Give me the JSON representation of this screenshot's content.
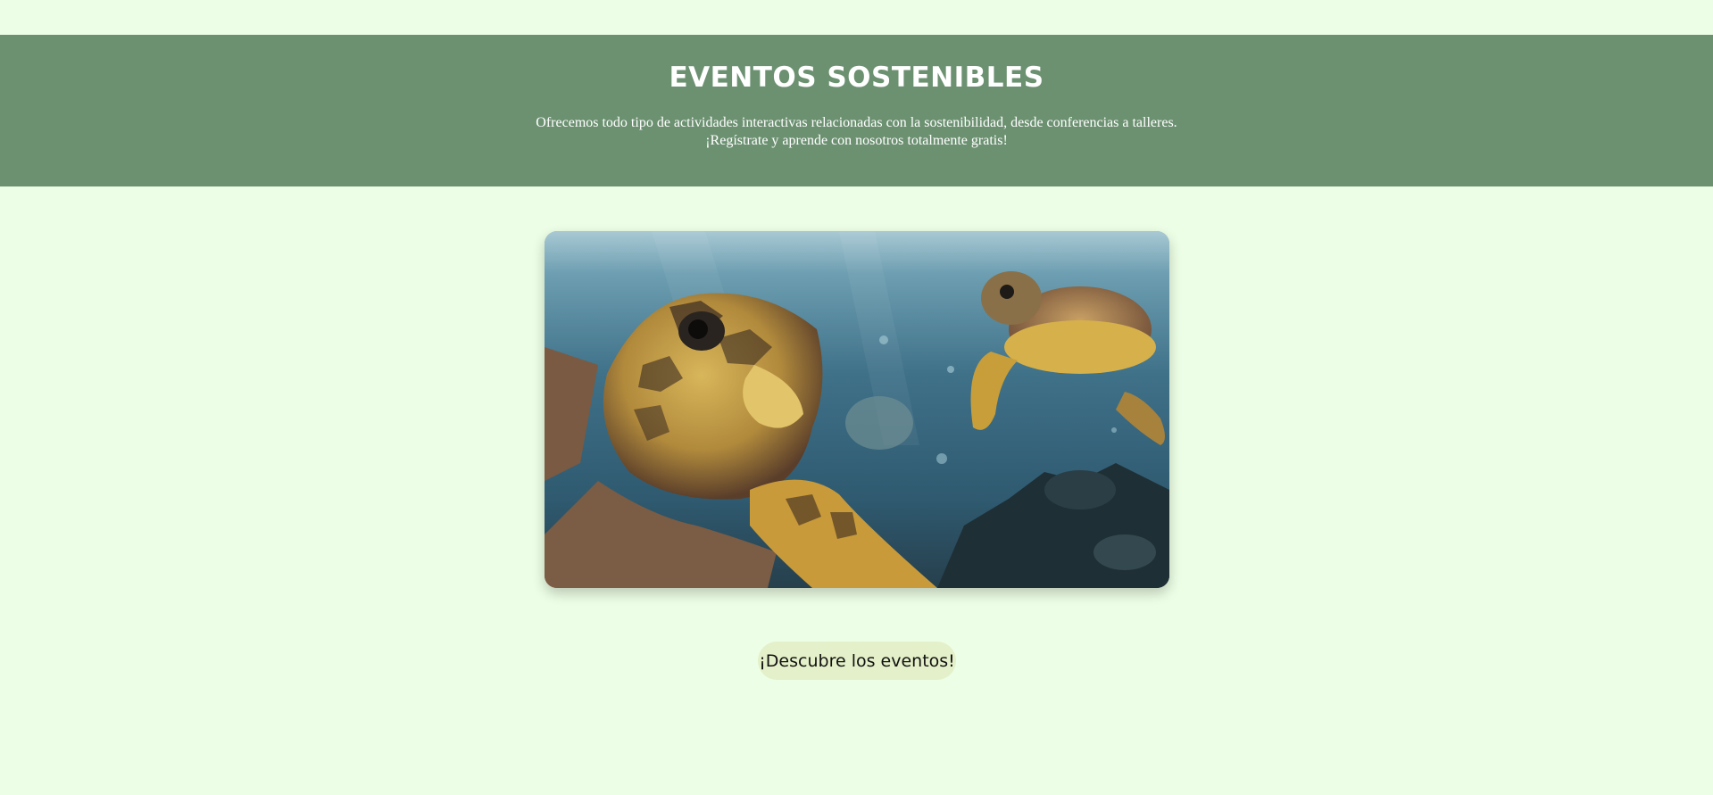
{
  "hero": {
    "title": "EVENTOS SOSTENIBLES",
    "description_line1": "Ofrecemos todo tipo de actividades interactivas relacionadas con la sostenibilidad, desde conferencias a talleres.",
    "description_line2": "¡Regístrate y aprende con nosotros totalmente gratis!"
  },
  "image": {
    "icon": "sea-turtles-photo"
  },
  "cta": {
    "label": "¡Descubre los eventos!"
  },
  "colors": {
    "page_background": "#ecfee5",
    "hero_background": "#6c9171",
    "button_background": "#e4f0c9"
  }
}
